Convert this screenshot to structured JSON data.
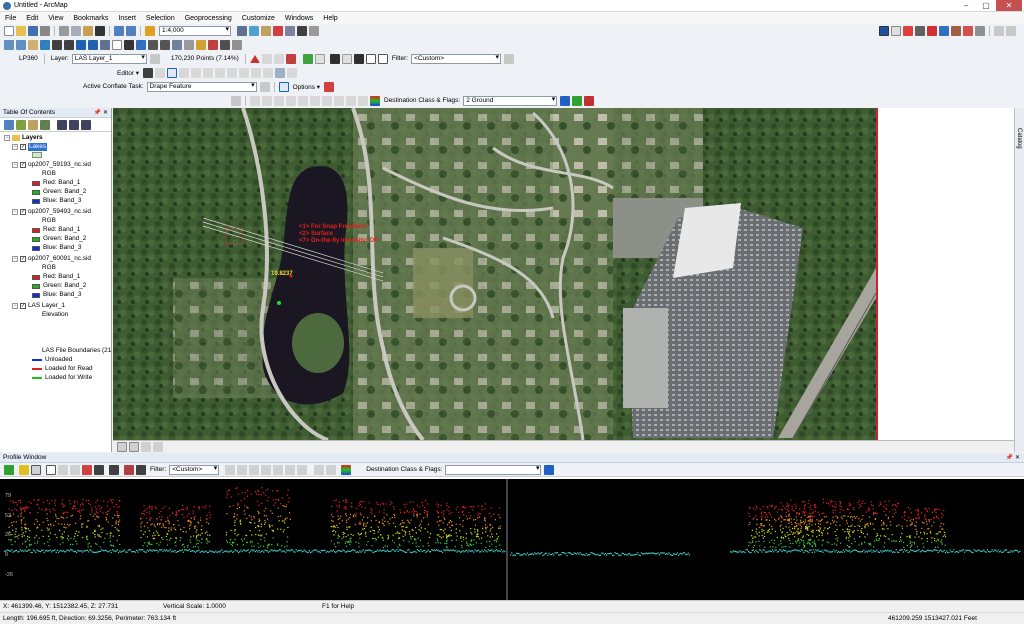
{
  "window": {
    "title": "Untitled - ArcMap"
  },
  "menu": [
    "File",
    "Edit",
    "View",
    "Bookmarks",
    "Insert",
    "Selection",
    "Geoprocessing",
    "Customize",
    "Windows",
    "Help"
  ],
  "standard_toolbar": {
    "scale": "1:4,000"
  },
  "lp360_toolbar": {
    "name": "LP360",
    "layer_label": "Layer:",
    "layer_value": "LAS Layer_1",
    "points": "170,230 Points (7.14%)",
    "filter_label": "Filter:",
    "filter_value": "<Custom>"
  },
  "editor_toolbar": {
    "editor": "Editor ▾"
  },
  "conflate_toolbar": {
    "task_label": "Active Conflate Task:",
    "task_value": "Drape Feature",
    "options": "Options ▾"
  },
  "classify_toolbar": {
    "dest_label": "Destination Class & Flags:",
    "dest_value": "2  Ground"
  },
  "toc": {
    "title": "Table Of Contents",
    "items": [
      {
        "label": "Layers"
      },
      {
        "label": "Lakes"
      },
      {
        "label": "op2007_59193_nc.sid"
      },
      {
        "label": "RGB"
      },
      {
        "label": "Red:   Band_1"
      },
      {
        "label": "Green: Band_2"
      },
      {
        "label": "Blue:   Band_3"
      },
      {
        "label": "op2007_59493_nc.sid"
      },
      {
        "label": "RGB"
      },
      {
        "label": "Red:   Band_1"
      },
      {
        "label": "Green: Band_2"
      },
      {
        "label": "Blue:   Band_3"
      },
      {
        "label": "op2007_60091_nc.sid"
      },
      {
        "label": "RGB"
      },
      {
        "label": "Red:   Band_1"
      },
      {
        "label": "Green: Band_2"
      },
      {
        "label": "Blue:   Band_3"
      },
      {
        "label": "LAS Layer_1"
      },
      {
        "label": "Elevation"
      },
      {
        "label": "LAS File Boundaries (21"
      },
      {
        "label": "Unloaded"
      },
      {
        "label": "Loaded for Read"
      },
      {
        "label": "Loaded for Write"
      }
    ]
  },
  "map": {
    "overlay_lines": [
      "<1> For Snap Freehand",
      "<2> Surface",
      "<7> On-the-fly Intensity: Off"
    ],
    "distance": "10.8237"
  },
  "catalog_tab": "Catalog",
  "profile_window": {
    "title": "Profile Window",
    "filter_label": "Filter:",
    "filter_value": "<Custom>",
    "dest_label": "Destination Class & Flags:",
    "dest_value": "",
    "y_ticks": [
      "79",
      "52",
      "26",
      "0",
      "-26"
    ]
  },
  "status": {
    "coords": "X: 461399.46, Y: 1512382.45, Z: 27.731",
    "vscale": "Vertical Scale: 1.0000",
    "help": "F1 for Help",
    "length": "Length: 196.695 ft, Direction: 69.3256, Perimeter: 763.134 ft",
    "map_coords": "461209.259  1513427.021 Feet"
  },
  "colors": {
    "toolbar_bg": "#eef1f5",
    "panel_header": "#e4ebf4",
    "las_unloaded": "#1030d0",
    "las_read": "#e02020",
    "las_write": "#20c020",
    "band_red": "#e02020",
    "band_green": "#20b020",
    "band_blue": "#1030d0",
    "lakes_fill": "#c8f0c0"
  }
}
